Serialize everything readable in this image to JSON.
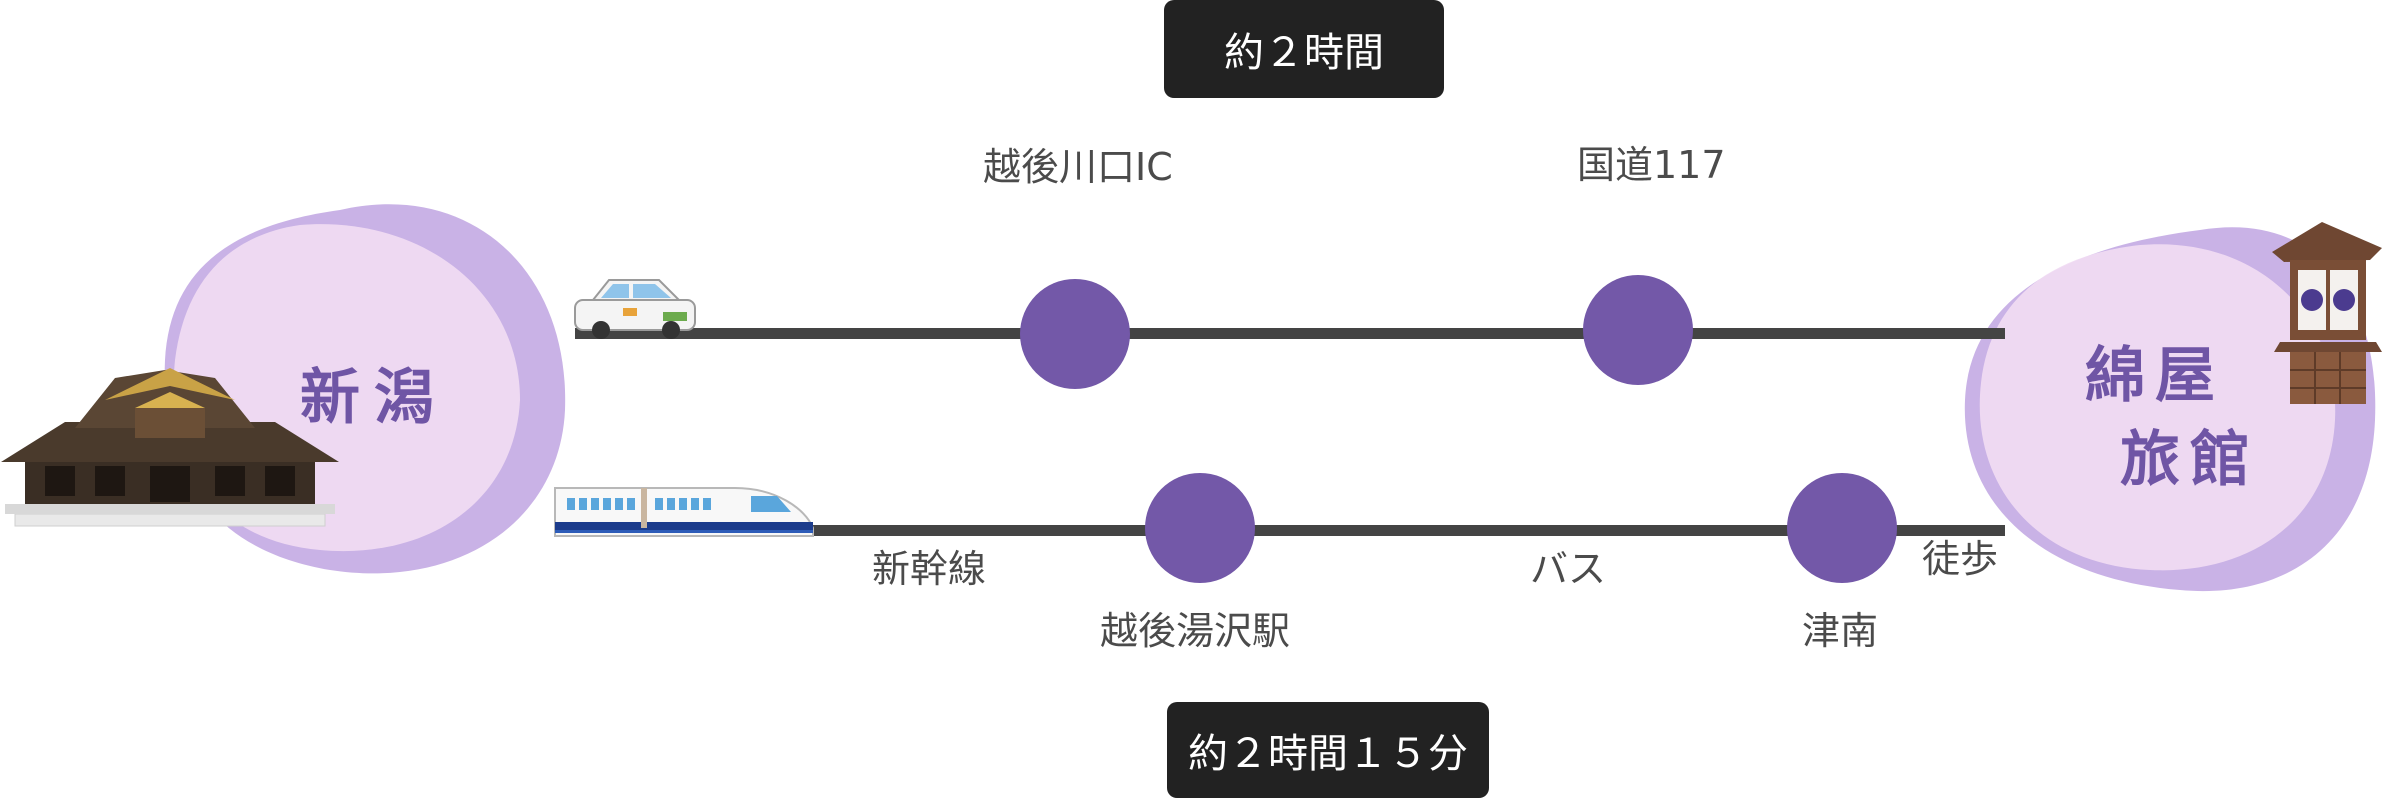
{
  "car_route": {
    "duration": "約２時間",
    "stops": [
      "越後川口IC",
      "国道117"
    ]
  },
  "train_route": {
    "duration": "約２時間１５分",
    "stops": [
      "越後湯沢駅",
      "津南"
    ],
    "segments": [
      "新幹線",
      "バス",
      "徒歩"
    ]
  },
  "origin": {
    "name_line1": "新潟"
  },
  "destination": {
    "name_line1": "綿屋",
    "name_line2": "旅館"
  },
  "colors": {
    "line": "#444444",
    "node": "#7358a8",
    "blob_light": "#f1dcf3",
    "blob_dark": "#c9b2e6",
    "pill": "#222222"
  }
}
